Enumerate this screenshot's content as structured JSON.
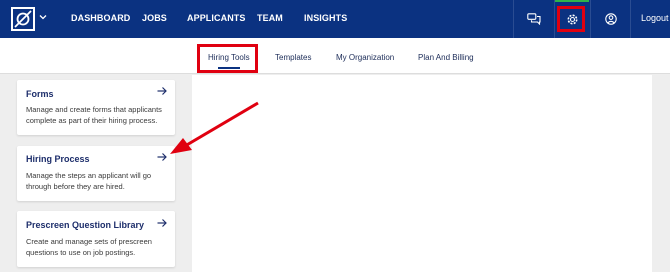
{
  "nav": {
    "items": [
      "DASHBOARD",
      "JOBS",
      "APPLICANTS",
      "TEAM",
      "INSIGHTS"
    ],
    "logout": "Logout"
  },
  "subnav": {
    "items": [
      "Hiring Tools",
      "Templates",
      "My Organization",
      "Plan And Billing"
    ],
    "active": "Hiring Tools"
  },
  "cards": [
    {
      "title": "Forms",
      "desc": "Manage and create forms that applicants complete as part of their hiring process."
    },
    {
      "title": "Hiring Process",
      "desc": "Manage the steps an applicant will go through before they are hired."
    },
    {
      "title": "Prescreen Question Library",
      "desc": "Create and manage sets of prescreen questions to use on job postings."
    }
  ],
  "icons": {
    "chat": "chat-icon",
    "settings": "gear-icon",
    "account": "user-circle-icon",
    "arrow": "arrow-right-icon"
  },
  "colors": {
    "nav_bg": "#0b3281",
    "highlight": "#e00010",
    "active_indicator": "#2fb34a",
    "card_title": "#1d2e6b"
  }
}
